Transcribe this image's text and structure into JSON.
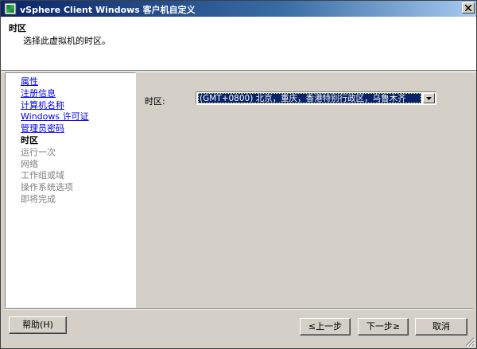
{
  "window": {
    "title": "vSphere Client Windows 客户机自定义",
    "app_icon": "vsphere-app-icon",
    "close_icon": "close-icon"
  },
  "header": {
    "title": "时区",
    "subtitle": "选择此虚拟机的时区。"
  },
  "sidebar": {
    "items": [
      {
        "label": "属性",
        "state": "link"
      },
      {
        "label": "注册信息",
        "state": "link"
      },
      {
        "label": "计算机名称",
        "state": "link"
      },
      {
        "label": "Windows 许可证",
        "state": "link"
      },
      {
        "label": "管理员密码",
        "state": "link"
      },
      {
        "label": "时区",
        "state": "current"
      },
      {
        "label": "运行一次",
        "state": "disabled"
      },
      {
        "label": "网络",
        "state": "disabled"
      },
      {
        "label": "工作组或域",
        "state": "disabled"
      },
      {
        "label": "操作系统选项",
        "state": "disabled"
      },
      {
        "label": "即将完成",
        "state": "disabled"
      }
    ]
  },
  "main": {
    "timezone_label": "时区:",
    "timezone_value": "(GMT+0800) 北京，重庆，香港特别行政区，乌鲁木齐"
  },
  "buttons": {
    "help": "帮助(H)",
    "back": "≤上一步",
    "next": "下一步≥",
    "cancel": "取消"
  },
  "colors": {
    "title_bar": "#0a246a",
    "link": "#0000ee",
    "disabled": "#808080",
    "selection": "#0a246a"
  }
}
